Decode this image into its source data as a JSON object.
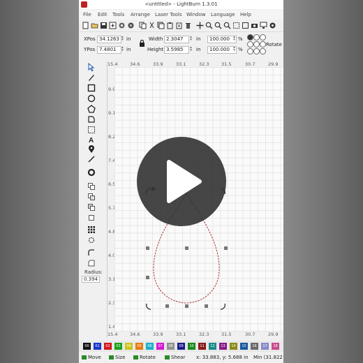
{
  "window": {
    "title": "<untitled> - LightBurn 1.3.01"
  },
  "menu": [
    "File",
    "Edit",
    "Tools",
    "Arrange",
    "Laser Tools",
    "Window",
    "Language",
    "Help"
  ],
  "position": {
    "xpos_label": "XPos",
    "xpos_value": "34.1263",
    "ypos_label": "YPos",
    "ypos_value": "7.4801",
    "unit": "in",
    "width_label": "Width",
    "width_value": "2.3047",
    "height_label": "Height",
    "height_value": "3.5985",
    "scale_w": "100.000",
    "scale_h": "100.000",
    "pct": "%",
    "rotate_label": "Rotate"
  },
  "rulers": {
    "top": [
      "15.4",
      "34.6",
      "33.9",
      "33.1",
      "32.3",
      "31.5",
      "30.7",
      "29.9"
    ],
    "bottom": [
      "15.4",
      "34.6",
      "33.9",
      "33.1",
      "32.3",
      "31.5",
      "30.7",
      "29.9"
    ],
    "left": [
      "9.9",
      "9.1",
      "8.2",
      "7.4",
      "6.5",
      "5.7",
      "4.8",
      "4.0",
      "3.1",
      "2.3",
      "1.4"
    ]
  },
  "tools": {
    "radius_label": "Radius:",
    "radius_value": "0.394"
  },
  "palette": [
    "00",
    "01",
    "02",
    "03",
    "04",
    "05",
    "06",
    "07",
    "08",
    "09",
    "10",
    "11",
    "12",
    "13",
    "14",
    "15",
    "16",
    "17",
    "18"
  ],
  "palette_colors": [
    "#111111",
    "#1a36c8",
    "#d01919",
    "#1aa21a",
    "#c9c51a",
    "#e67a12",
    "#1ab0c8",
    "#d21ad2",
    "#909090",
    "#1a1a8a",
    "#1a8a1a",
    "#8a1a1a",
    "#1a8a8a",
    "#8a1a8a",
    "#8a8a1a",
    "#1a5aa0",
    "#6a6a6a",
    "#8a8ac8",
    "#c84a8a"
  ],
  "status": {
    "move": "Move",
    "size": "Size",
    "rotate": "Rotate",
    "shear": "Shear",
    "coords": "x: 33.883, y: 5.688 in",
    "min": "Min (31.822"
  }
}
